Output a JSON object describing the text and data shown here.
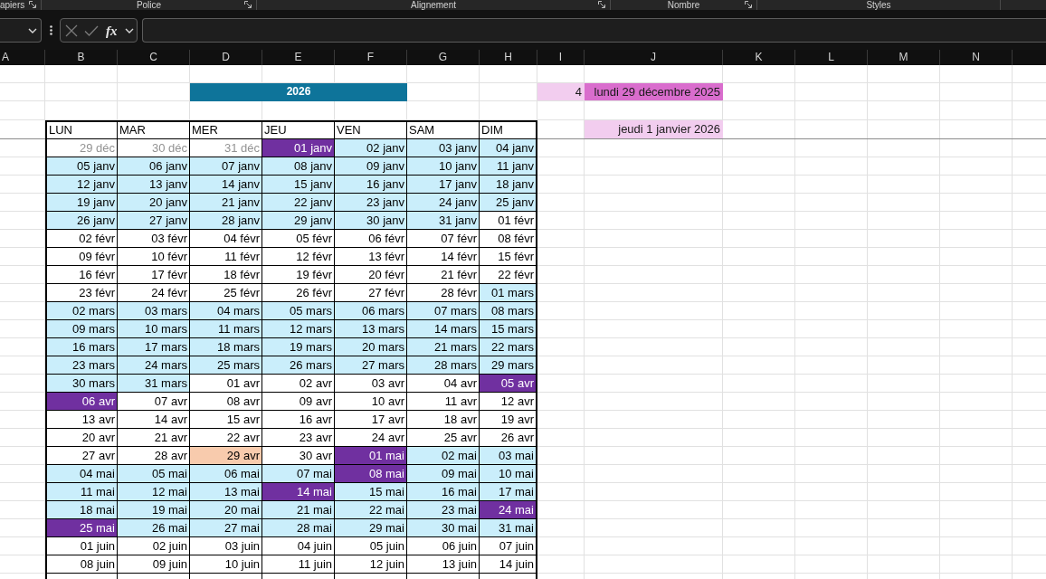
{
  "ribbon_groups": [
    {
      "label": "apiers",
      "launcher": true
    },
    {
      "label": "Police",
      "launcher": true
    },
    {
      "label": "Alignement",
      "launcher": true
    },
    {
      "label": "Nombre",
      "launcher": true
    },
    {
      "label": "Styles",
      "launcher": false
    }
  ],
  "formula_bar": {
    "function_button": "fx"
  },
  "columns": [
    "A",
    "B",
    "C",
    "D",
    "E",
    "F",
    "G",
    "H",
    "I",
    "J",
    "K",
    "L",
    "M",
    "N"
  ],
  "cells": {
    "year_banner": "2026",
    "cell_I2": "4",
    "cell_J2": "lundi 29 décembre 2025",
    "cell_J4": "jeudi 1 janvier 2026"
  },
  "calendar": {
    "weekdays": [
      "LUN",
      "MAR",
      "MER",
      "JEU",
      "VEN",
      "SAM",
      "DIM"
    ],
    "weeks": [
      [
        {
          "text": "29 déc",
          "kind": "outside"
        },
        {
          "text": "30 déc",
          "kind": "outside"
        },
        {
          "text": "31 déc",
          "kind": "outside"
        },
        {
          "text": "01 janv",
          "kind": "holiday"
        },
        {
          "text": "02 janv",
          "kind": "shaded"
        },
        {
          "text": "03 janv",
          "kind": "shaded"
        },
        {
          "text": "04 janv",
          "kind": "shaded"
        }
      ],
      [
        {
          "text": "05 janv",
          "kind": "shaded"
        },
        {
          "text": "06 janv",
          "kind": "shaded"
        },
        {
          "text": "07 janv",
          "kind": "shaded"
        },
        {
          "text": "08 janv",
          "kind": "shaded"
        },
        {
          "text": "09 janv",
          "kind": "shaded"
        },
        {
          "text": "10 janv",
          "kind": "shaded"
        },
        {
          "text": "11 janv",
          "kind": "shaded"
        }
      ],
      [
        {
          "text": "12 janv",
          "kind": "shaded"
        },
        {
          "text": "13 janv",
          "kind": "shaded"
        },
        {
          "text": "14 janv",
          "kind": "shaded"
        },
        {
          "text": "15 janv",
          "kind": "shaded"
        },
        {
          "text": "16 janv",
          "kind": "shaded"
        },
        {
          "text": "17 janv",
          "kind": "shaded"
        },
        {
          "text": "18 janv",
          "kind": "shaded"
        }
      ],
      [
        {
          "text": "19 janv",
          "kind": "shaded"
        },
        {
          "text": "20 janv",
          "kind": "shaded"
        },
        {
          "text": "21 janv",
          "kind": "shaded"
        },
        {
          "text": "22 janv",
          "kind": "shaded"
        },
        {
          "text": "23 janv",
          "kind": "shaded"
        },
        {
          "text": "24 janv",
          "kind": "shaded"
        },
        {
          "text": "25 janv",
          "kind": "shaded"
        }
      ],
      [
        {
          "text": "26 janv",
          "kind": "shaded"
        },
        {
          "text": "27 janv",
          "kind": "shaded"
        },
        {
          "text": "28 janv",
          "kind": "shaded"
        },
        {
          "text": "29 janv",
          "kind": "shaded"
        },
        {
          "text": "30 janv",
          "kind": "shaded"
        },
        {
          "text": "31 janv",
          "kind": "shaded"
        },
        {
          "text": "01 févr",
          "kind": "plain"
        }
      ],
      [
        {
          "text": "02 févr",
          "kind": "plain"
        },
        {
          "text": "03 févr",
          "kind": "plain"
        },
        {
          "text": "04 févr",
          "kind": "plain"
        },
        {
          "text": "05 févr",
          "kind": "plain"
        },
        {
          "text": "06 févr",
          "kind": "plain"
        },
        {
          "text": "07 févr",
          "kind": "plain"
        },
        {
          "text": "08 févr",
          "kind": "plain"
        }
      ],
      [
        {
          "text": "09 févr",
          "kind": "plain"
        },
        {
          "text": "10 févr",
          "kind": "plain"
        },
        {
          "text": "11 févr",
          "kind": "plain"
        },
        {
          "text": "12 févr",
          "kind": "plain"
        },
        {
          "text": "13 févr",
          "kind": "plain"
        },
        {
          "text": "14 févr",
          "kind": "plain"
        },
        {
          "text": "15 févr",
          "kind": "plain"
        }
      ],
      [
        {
          "text": "16 févr",
          "kind": "plain"
        },
        {
          "text": "17 févr",
          "kind": "plain"
        },
        {
          "text": "18 févr",
          "kind": "plain"
        },
        {
          "text": "19 févr",
          "kind": "plain"
        },
        {
          "text": "20 févr",
          "kind": "plain"
        },
        {
          "text": "21 févr",
          "kind": "plain"
        },
        {
          "text": "22 févr",
          "kind": "plain"
        }
      ],
      [
        {
          "text": "23 févr",
          "kind": "plain"
        },
        {
          "text": "24 févr",
          "kind": "plain"
        },
        {
          "text": "25 févr",
          "kind": "plain"
        },
        {
          "text": "26 févr",
          "kind": "plain"
        },
        {
          "text": "27 févr",
          "kind": "plain"
        },
        {
          "text": "28 févr",
          "kind": "plain"
        },
        {
          "text": "01 mars",
          "kind": "shaded"
        }
      ],
      [
        {
          "text": "02 mars",
          "kind": "shaded"
        },
        {
          "text": "03 mars",
          "kind": "shaded"
        },
        {
          "text": "04 mars",
          "kind": "shaded"
        },
        {
          "text": "05 mars",
          "kind": "shaded"
        },
        {
          "text": "06 mars",
          "kind": "shaded"
        },
        {
          "text": "07 mars",
          "kind": "shaded"
        },
        {
          "text": "08 mars",
          "kind": "shaded"
        }
      ],
      [
        {
          "text": "09 mars",
          "kind": "shaded"
        },
        {
          "text": "10 mars",
          "kind": "shaded"
        },
        {
          "text": "11 mars",
          "kind": "shaded"
        },
        {
          "text": "12 mars",
          "kind": "shaded"
        },
        {
          "text": "13 mars",
          "kind": "shaded"
        },
        {
          "text": "14 mars",
          "kind": "shaded"
        },
        {
          "text": "15 mars",
          "kind": "shaded"
        }
      ],
      [
        {
          "text": "16 mars",
          "kind": "shaded"
        },
        {
          "text": "17 mars",
          "kind": "shaded"
        },
        {
          "text": "18 mars",
          "kind": "shaded"
        },
        {
          "text": "19 mars",
          "kind": "shaded"
        },
        {
          "text": "20 mars",
          "kind": "shaded"
        },
        {
          "text": "21 mars",
          "kind": "shaded"
        },
        {
          "text": "22 mars",
          "kind": "shaded"
        }
      ],
      [
        {
          "text": "23 mars",
          "kind": "shaded"
        },
        {
          "text": "24 mars",
          "kind": "shaded"
        },
        {
          "text": "25 mars",
          "kind": "shaded"
        },
        {
          "text": "26 mars",
          "kind": "shaded"
        },
        {
          "text": "27 mars",
          "kind": "shaded"
        },
        {
          "text": "28 mars",
          "kind": "shaded"
        },
        {
          "text": "29 mars",
          "kind": "shaded"
        }
      ],
      [
        {
          "text": "30 mars",
          "kind": "shaded"
        },
        {
          "text": "31 mars",
          "kind": "shaded"
        },
        {
          "text": "01 avr",
          "kind": "plain"
        },
        {
          "text": "02 avr",
          "kind": "plain"
        },
        {
          "text": "03 avr",
          "kind": "plain"
        },
        {
          "text": "04 avr",
          "kind": "plain"
        },
        {
          "text": "05 avr",
          "kind": "holiday"
        }
      ],
      [
        {
          "text": "06 avr",
          "kind": "holiday"
        },
        {
          "text": "07 avr",
          "kind": "plain"
        },
        {
          "text": "08 avr",
          "kind": "plain"
        },
        {
          "text": "09 avr",
          "kind": "plain"
        },
        {
          "text": "10 avr",
          "kind": "plain"
        },
        {
          "text": "11 avr",
          "kind": "plain"
        },
        {
          "text": "12 avr",
          "kind": "plain"
        }
      ],
      [
        {
          "text": "13 avr",
          "kind": "plain"
        },
        {
          "text": "14 avr",
          "kind": "plain"
        },
        {
          "text": "15 avr",
          "kind": "plain"
        },
        {
          "text": "16 avr",
          "kind": "plain"
        },
        {
          "text": "17 avr",
          "kind": "plain"
        },
        {
          "text": "18 avr",
          "kind": "plain"
        },
        {
          "text": "19 avr",
          "kind": "plain"
        }
      ],
      [
        {
          "text": "20 avr",
          "kind": "plain"
        },
        {
          "text": "21 avr",
          "kind": "plain"
        },
        {
          "text": "22 avr",
          "kind": "plain"
        },
        {
          "text": "23 avr",
          "kind": "plain"
        },
        {
          "text": "24 avr",
          "kind": "plain"
        },
        {
          "text": "25 avr",
          "kind": "plain"
        },
        {
          "text": "26 avr",
          "kind": "plain"
        }
      ],
      [
        {
          "text": "27 avr",
          "kind": "plain"
        },
        {
          "text": "28 avr",
          "kind": "plain"
        },
        {
          "text": "29 avr",
          "kind": "highlight"
        },
        {
          "text": "30 avr",
          "kind": "plain"
        },
        {
          "text": "01 mai",
          "kind": "holiday"
        },
        {
          "text": "02 mai",
          "kind": "shaded"
        },
        {
          "text": "03 mai",
          "kind": "shaded"
        }
      ],
      [
        {
          "text": "04 mai",
          "kind": "shaded"
        },
        {
          "text": "05 mai",
          "kind": "shaded"
        },
        {
          "text": "06 mai",
          "kind": "shaded"
        },
        {
          "text": "07 mai",
          "kind": "shaded"
        },
        {
          "text": "08 mai",
          "kind": "holiday"
        },
        {
          "text": "09 mai",
          "kind": "shaded"
        },
        {
          "text": "10 mai",
          "kind": "shaded"
        }
      ],
      [
        {
          "text": "11 mai",
          "kind": "shaded"
        },
        {
          "text": "12 mai",
          "kind": "shaded"
        },
        {
          "text": "13 mai",
          "kind": "shaded"
        },
        {
          "text": "14 mai",
          "kind": "holiday"
        },
        {
          "text": "15 mai",
          "kind": "shaded"
        },
        {
          "text": "16 mai",
          "kind": "shaded"
        },
        {
          "text": "17 mai",
          "kind": "shaded"
        }
      ],
      [
        {
          "text": "18 mai",
          "kind": "shaded"
        },
        {
          "text": "19 mai",
          "kind": "shaded"
        },
        {
          "text": "20 mai",
          "kind": "shaded"
        },
        {
          "text": "21 mai",
          "kind": "shaded"
        },
        {
          "text": "22 mai",
          "kind": "shaded"
        },
        {
          "text": "23 mai",
          "kind": "shaded"
        },
        {
          "text": "24 mai",
          "kind": "holiday"
        }
      ],
      [
        {
          "text": "25 mai",
          "kind": "holiday"
        },
        {
          "text": "26 mai",
          "kind": "shaded"
        },
        {
          "text": "27 mai",
          "kind": "shaded"
        },
        {
          "text": "28 mai",
          "kind": "shaded"
        },
        {
          "text": "29 mai",
          "kind": "shaded"
        },
        {
          "text": "30 mai",
          "kind": "shaded"
        },
        {
          "text": "31 mai",
          "kind": "shaded"
        }
      ],
      [
        {
          "text": "01 juin",
          "kind": "plain"
        },
        {
          "text": "02 juin",
          "kind": "plain"
        },
        {
          "text": "03 juin",
          "kind": "plain"
        },
        {
          "text": "04 juin",
          "kind": "plain"
        },
        {
          "text": "05 juin",
          "kind": "plain"
        },
        {
          "text": "06 juin",
          "kind": "plain"
        },
        {
          "text": "07 juin",
          "kind": "plain"
        }
      ],
      [
        {
          "text": "08 juin",
          "kind": "plain"
        },
        {
          "text": "09 juin",
          "kind": "plain"
        },
        {
          "text": "10 juin",
          "kind": "plain"
        },
        {
          "text": "11 juin",
          "kind": "plain"
        },
        {
          "text": "12 juin",
          "kind": "plain"
        },
        {
          "text": "13 juin",
          "kind": "plain"
        },
        {
          "text": "14 juin",
          "kind": "plain"
        }
      ]
    ]
  }
}
